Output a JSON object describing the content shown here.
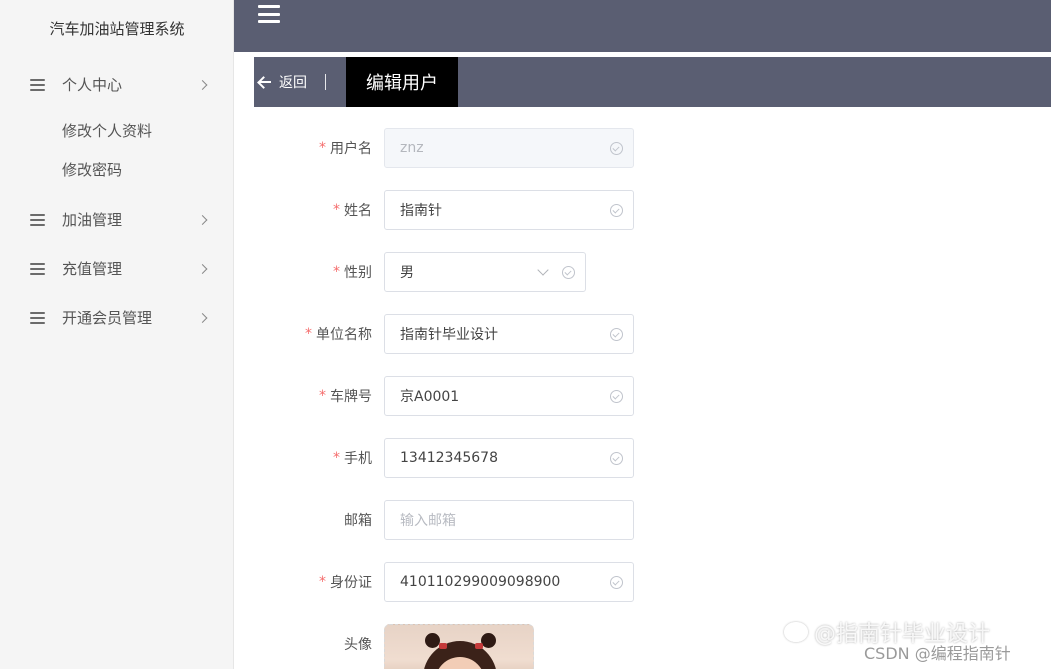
{
  "app": {
    "title": "汽车加油站管理系统"
  },
  "sidebar": {
    "groups": [
      {
        "label": "个人中心",
        "items": [
          {
            "label": "修改个人资料"
          },
          {
            "label": "修改密码"
          }
        ]
      },
      {
        "label": "加油管理"
      },
      {
        "label": "充值管理"
      },
      {
        "label": "开通会员管理"
      }
    ]
  },
  "header": {
    "back_label": "返回",
    "page_title": "编辑用户"
  },
  "form": {
    "username": {
      "label": "用户名",
      "value": "znz"
    },
    "name": {
      "label": "姓名",
      "value": "指南针"
    },
    "gender": {
      "label": "性别",
      "value": "男"
    },
    "company": {
      "label": "单位名称",
      "value": "指南针毕业设计"
    },
    "plate": {
      "label": "车牌号",
      "value": "京A0001"
    },
    "phone": {
      "label": "手机",
      "value": "13412345678"
    },
    "email": {
      "label": "邮箱",
      "placeholder": "输入邮箱"
    },
    "idcard": {
      "label": "身份证",
      "value": "410110299009098900"
    },
    "avatar": {
      "label": "头像"
    }
  },
  "watermark": {
    "primary": "@指南针毕业设计",
    "secondary": "CSDN @编程指南针"
  },
  "colors": {
    "topbar": "#5a5e72",
    "title_bg": "#000000",
    "required": "#f56c6c"
  }
}
